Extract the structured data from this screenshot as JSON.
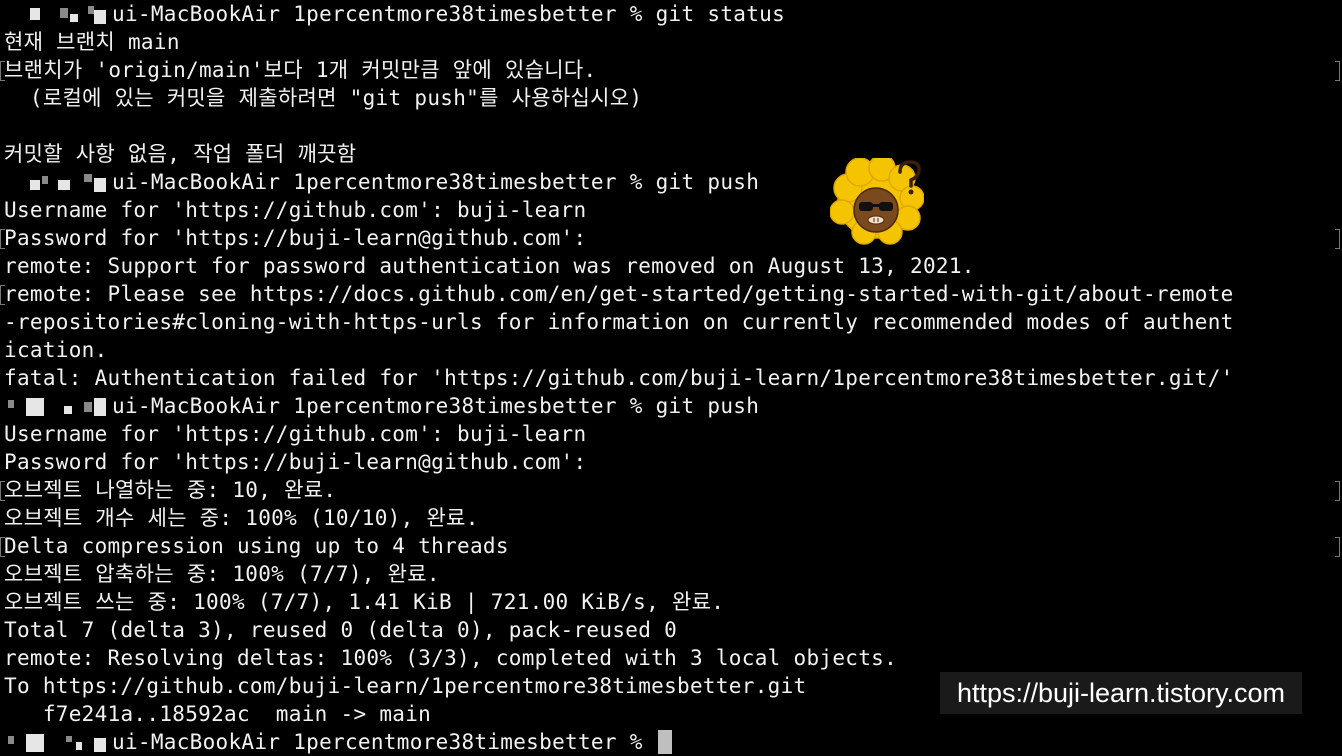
{
  "terminal": {
    "lines": [
      "ui-MacBookAir 1percentmore38timesbetter % git status",
      "현재 브랜치 main",
      "브랜치가 'origin/main'보다 1개 커밋만큼 앞에 있습니다.",
      "  (로컬에 있는 커밋을 제출하려면 \"git push\"를 사용하십시오)",
      "",
      "커밋할 사항 없음, 작업 폴더 깨끗함",
      "ui-MacBookAir 1percentmore38timesbetter % git push",
      "Username for 'https://github.com': buji-learn",
      "Password for 'https://buji-learn@github.com':",
      "remote: Support for password authentication was removed on August 13, 2021.",
      "remote: Please see https://docs.github.com/en/get-started/getting-started-with-git/about-remote",
      "-repositories#cloning-with-https-urls for information on currently recommended modes of authent",
      "ication.",
      "fatal: Authentication failed for 'https://github.com/buji-learn/1percentmore38timesbetter.git/'",
      "ui-MacBookAir 1percentmore38timesbetter % git push",
      "Username for 'https://github.com': buji-learn",
      "Password for 'https://buji-learn@github.com':",
      "오브젝트 나열하는 중: 10, 완료.",
      "오브젝트 개수 세는 중: 100% (10/10), 완료.",
      "Delta compression using up to 4 threads",
      "오브젝트 압축하는 중: 100% (7/7), 완료.",
      "오브젝트 쓰는 중: 100% (7/7), 1.41 KiB | 721.00 KiB/s, 완료.",
      "Total 7 (delta 3), reused 0 (delta 0), pack-reused 0",
      "remote: Resolving deltas: 100% (3/3), completed with 3 local objects.",
      "To https://github.com/buji-learn/1percentmore38timesbetter.git",
      "   f7e241a..18592ac  main -> main",
      "ui-MacBookAir 1percentmore38timesbetter % "
    ]
  },
  "watermark": {
    "text": "https://buji-learn.tistory.com"
  },
  "avatar_icon": "afro-character-sticker-icon",
  "colors": {
    "background": "#000000",
    "text": "#f2f2f2",
    "cursor": "#bfbfbf",
    "sticker_yellow": "#f5c400"
  }
}
